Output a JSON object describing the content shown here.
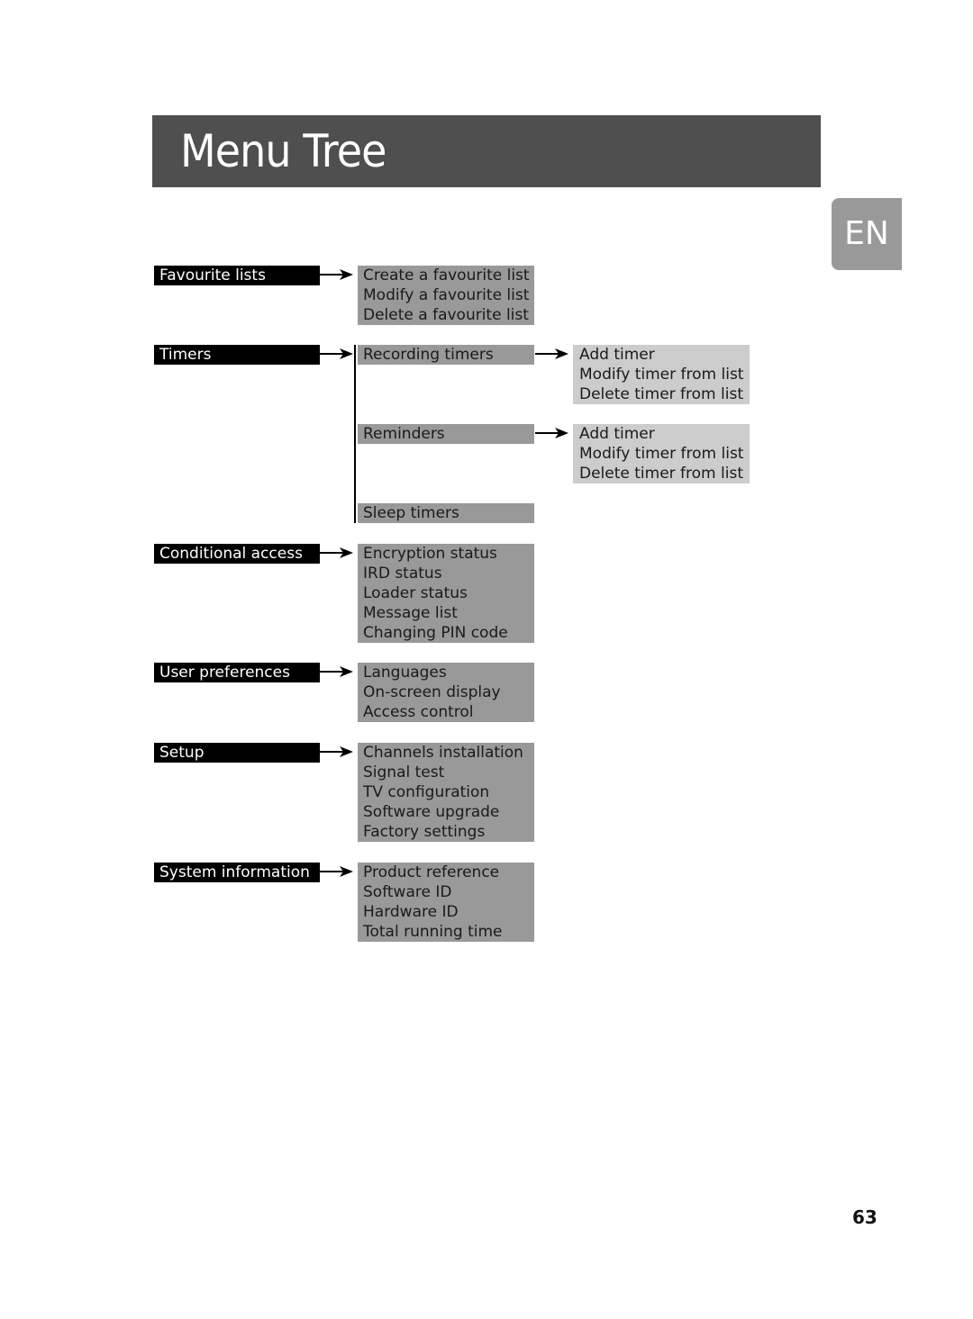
{
  "header": {
    "title": "Menu Tree"
  },
  "language_tab": "EN",
  "page_number": "63",
  "tree": {
    "favourite": {
      "label": "Favourite lists",
      "items": [
        "Create a favourite list",
        "Modify a favourite list",
        "Delete a favourite list"
      ]
    },
    "timers": {
      "label": "Timers",
      "recording": {
        "label": "Recording timers",
        "items": [
          "Add timer",
          "Modify timer from list",
          "Delete timer from list"
        ]
      },
      "reminders": {
        "label": "Reminders",
        "items": [
          "Add timer",
          "Modify timer from list",
          "Delete timer from list"
        ]
      },
      "sleep": {
        "label": "Sleep timers"
      }
    },
    "conditional": {
      "label": "Conditional access",
      "items": [
        "Encryption status",
        "IRD status",
        "Loader status",
        "Message list",
        "Changing PIN code"
      ]
    },
    "user_prefs": {
      "label": "User preferences",
      "items": [
        "Languages",
        "On-screen display",
        "Access control"
      ]
    },
    "setup": {
      "label": "Setup",
      "items": [
        "Channels installation",
        "Signal test",
        "TV configuration",
        "Software upgrade",
        "Factory settings"
      ]
    },
    "sysinfo": {
      "label": "System information",
      "items": [
        "Product reference",
        "Software ID",
        "Hardware ID",
        "Total running time"
      ]
    }
  }
}
